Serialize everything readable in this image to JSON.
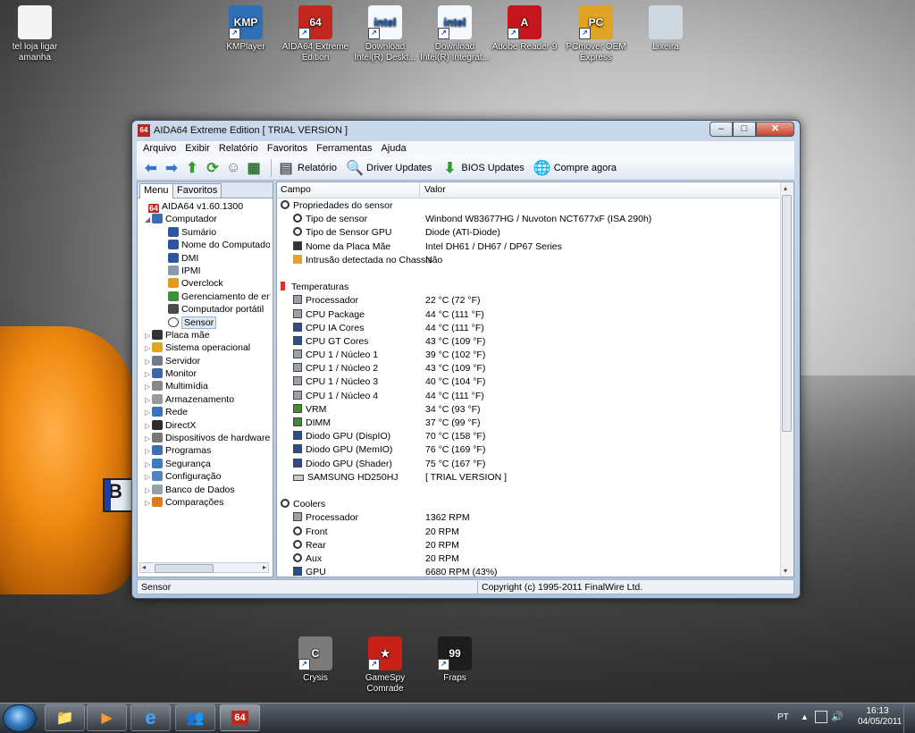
{
  "desktop_icons": [
    {
      "label": "tel loja ligar\namanha",
      "glyph": "",
      "color": "#f4f4f4"
    },
    {
      "label": "KMPlayer",
      "glyph": "KMP",
      "color": "#2e6fb6"
    },
    {
      "label": "AIDA64 Extreme\nEdition",
      "glyph": "64",
      "color": "#c0281f"
    },
    {
      "label": "Download\nIntel(R) Deskt...",
      "glyph": "intel",
      "color": "#f4f8ff"
    },
    {
      "label": "Download\nIntel(R) Integrat...",
      "glyph": "intel",
      "color": "#f4f8ff"
    },
    {
      "label": "Adobe Reader 9",
      "glyph": "A",
      "color": "#c5161d"
    },
    {
      "label": "PCmover OEM\nExpress",
      "glyph": "PC",
      "color": "#e0a323"
    },
    {
      "label": "Lixeira",
      "glyph": "",
      "color": "#cfd8e0"
    },
    {
      "label": "Crysis",
      "glyph": "C",
      "color": "#7b7b7b"
    },
    {
      "label": "GameSpy\nComrade",
      "glyph": "★",
      "color": "#c9201a"
    },
    {
      "label": "Fraps",
      "glyph": "99",
      "color": "#1d1d1d"
    }
  ],
  "window": {
    "title": "AIDA64 Extreme Edition  [ TRIAL VERSION ]",
    "app_icon_text": "64",
    "controls": {
      "min": "–",
      "max": "□",
      "close": "✕"
    }
  },
  "menu": [
    "Arquivo",
    "Exibir",
    "Relatório",
    "Favoritos",
    "Ferramentas",
    "Ajuda"
  ],
  "toolbar": {
    "report": "Relatório",
    "driver": "Driver Updates",
    "bios": "BIOS Updates",
    "buy": "Compre agora"
  },
  "left_tabs": {
    "menu": "Menu",
    "favorites": "Favoritos"
  },
  "tree": [
    {
      "label": "AIDA64 v1.60.1300",
      "indent": 0,
      "exp": "",
      "icon": "64",
      "color": "#c0281f"
    },
    {
      "label": "Computador",
      "indent": 1,
      "exp": "◢",
      "icon": "",
      "color": "#3b6db3"
    },
    {
      "label": "Sumário",
      "indent": 2,
      "exp": "",
      "icon": "",
      "color": "#2e55a0"
    },
    {
      "label": "Nome do Computador",
      "indent": 2,
      "exp": "",
      "icon": "",
      "color": "#2e55a0"
    },
    {
      "label": "DMI",
      "indent": 2,
      "exp": "",
      "icon": "",
      "color": "#2e55a0"
    },
    {
      "label": "IPMI",
      "indent": 2,
      "exp": "",
      "icon": "",
      "color": "#8a9aae"
    },
    {
      "label": "Overclock",
      "indent": 2,
      "exp": "",
      "icon": "",
      "color": "#e39a1e"
    },
    {
      "label": "Gerenciamento de energia",
      "indent": 2,
      "exp": "",
      "icon": "",
      "color": "#3e8f3a"
    },
    {
      "label": "Computador portátil",
      "indent": 2,
      "exp": "",
      "icon": "",
      "color": "#4a4a4a"
    },
    {
      "label": "Sensor",
      "indent": 2,
      "exp": "",
      "icon": "",
      "color": "#ffffff",
      "selected": true
    },
    {
      "label": "Placa mãe",
      "indent": 1,
      "exp": "▷",
      "icon": "",
      "color": "#333333"
    },
    {
      "label": "Sistema operacional",
      "indent": 1,
      "exp": "▷",
      "icon": "",
      "color": "#e5a521"
    },
    {
      "label": "Servidor",
      "indent": 1,
      "exp": "▷",
      "icon": "",
      "color": "#6f7b8a"
    },
    {
      "label": "Monitor",
      "indent": 1,
      "exp": "▷",
      "icon": "",
      "color": "#3c66aa"
    },
    {
      "label": "Multimídia",
      "indent": 1,
      "exp": "▷",
      "icon": "",
      "color": "#888888"
    },
    {
      "label": "Armazenamento",
      "indent": 1,
      "exp": "▷",
      "icon": "",
      "color": "#999999"
    },
    {
      "label": "Rede",
      "indent": 1,
      "exp": "▷",
      "icon": "",
      "color": "#3b73b8"
    },
    {
      "label": "DirectX",
      "indent": 1,
      "exp": "▷",
      "icon": "",
      "color": "#2c2c2c"
    },
    {
      "label": "Dispositivos de hardware",
      "indent": 1,
      "exp": "▷",
      "icon": "",
      "color": "#777777"
    },
    {
      "label": "Programas",
      "indent": 1,
      "exp": "▷",
      "icon": "",
      "color": "#3d6fb0"
    },
    {
      "label": "Segurança",
      "indent": 1,
      "exp": "▷",
      "icon": "",
      "color": "#3c7dbd"
    },
    {
      "label": "Configuração",
      "indent": 1,
      "exp": "▷",
      "icon": "",
      "color": "#4d83c0"
    },
    {
      "label": "Banco de Dados",
      "indent": 1,
      "exp": "▷",
      "icon": "",
      "color": "#9aa0a8"
    },
    {
      "label": "Comparações",
      "indent": 1,
      "exp": "▷",
      "icon": "",
      "color": "#e07a17"
    }
  ],
  "columns": {
    "field": "Campo",
    "value": "Valor"
  },
  "rows": [
    {
      "type": "group",
      "icon": "round",
      "field": "Propriedades do sensor",
      "value": ""
    },
    {
      "type": "item",
      "icon": "round",
      "field": "Tipo de sensor",
      "value": "Winbond W83677HG / Nuvoton NCT677xF  (ISA 290h)"
    },
    {
      "type": "item",
      "icon": "round",
      "field": "Tipo de Sensor GPU",
      "value": "Diode  (ATI-Diode)"
    },
    {
      "type": "item",
      "icon": "mb",
      "field": "Nome da Placa Mãe",
      "value": "Intel DH61 / DH67 / DP67 Series"
    },
    {
      "type": "item",
      "icon": "lock",
      "field": "Intrusão detectada no Chassis",
      "value": "Não"
    },
    {
      "type": "blank",
      "icon": "",
      "field": "",
      "value": ""
    },
    {
      "type": "group",
      "icon": "temp",
      "field": "Temperaturas",
      "value": ""
    },
    {
      "type": "item",
      "icon": "",
      "field": "Processador",
      "value": "22 °C  (72 °F)"
    },
    {
      "type": "item",
      "icon": "",
      "field": "CPU Package",
      "value": "44 °C  (111 °F)"
    },
    {
      "type": "item",
      "icon": "blue",
      "field": "CPU IA Cores",
      "value": "44 °C  (111 °F)"
    },
    {
      "type": "item",
      "icon": "blue",
      "field": "CPU GT Cores",
      "value": "43 °C  (109 °F)"
    },
    {
      "type": "item",
      "icon": "",
      "field": "CPU 1 / Núcleo 1",
      "value": "39 °C  (102 °F)"
    },
    {
      "type": "item",
      "icon": "",
      "field": "CPU 1 / Núcleo 2",
      "value": "43 °C  (109 °F)"
    },
    {
      "type": "item",
      "icon": "",
      "field": "CPU 1 / Núcleo 3",
      "value": "40 °C  (104 °F)"
    },
    {
      "type": "item",
      "icon": "",
      "field": "CPU 1 / Núcleo 4",
      "value": "44 °C  (111 °F)"
    },
    {
      "type": "item",
      "icon": "green",
      "field": "VRM",
      "value": "34 °C  (93 °F)"
    },
    {
      "type": "item",
      "icon": "dimm",
      "field": "DIMM",
      "value": "37 °C  (99 °F)"
    },
    {
      "type": "item",
      "icon": "blue",
      "field": "Diodo GPU (DispIO)",
      "value": "70 °C  (158 °F)"
    },
    {
      "type": "item",
      "icon": "blue",
      "field": "Diodo GPU (MemIO)",
      "value": "76 °C  (169 °F)"
    },
    {
      "type": "item",
      "icon": "blue",
      "field": "Diodo GPU (Shader)",
      "value": "75 °C  (167 °F)"
    },
    {
      "type": "item",
      "icon": "hdd",
      "field": "SAMSUNG HD250HJ",
      "value": "[ TRIAL VERSION ]"
    },
    {
      "type": "blank",
      "icon": "",
      "field": "",
      "value": ""
    },
    {
      "type": "group",
      "icon": "round",
      "field": "Coolers",
      "value": ""
    },
    {
      "type": "item",
      "icon": "",
      "field": "Processador",
      "value": "1362 RPM"
    },
    {
      "type": "item",
      "icon": "round",
      "field": "Front",
      "value": "20 RPM"
    },
    {
      "type": "item",
      "icon": "round",
      "field": "Rear",
      "value": "20 RPM"
    },
    {
      "type": "item",
      "icon": "round",
      "field": "Aux",
      "value": "20 RPM"
    },
    {
      "type": "item",
      "icon": "blue",
      "field": "GPU",
      "value": "6680 RPM  (43%)"
    }
  ],
  "status": {
    "left": "Sensor",
    "right": "Copyright (c) 1995-2011 FinalWire Ltd."
  },
  "taskbar": {
    "lang": "PT",
    "time": "16:13",
    "date": "04/05/2011",
    "buttons": [
      {
        "name": "explorer",
        "glyph": "📁"
      },
      {
        "name": "media-player",
        "glyph": "▶"
      },
      {
        "name": "internet-explorer",
        "glyph": "e"
      },
      {
        "name": "users",
        "glyph": "👥"
      },
      {
        "name": "aida64",
        "glyph": "64"
      }
    ]
  }
}
